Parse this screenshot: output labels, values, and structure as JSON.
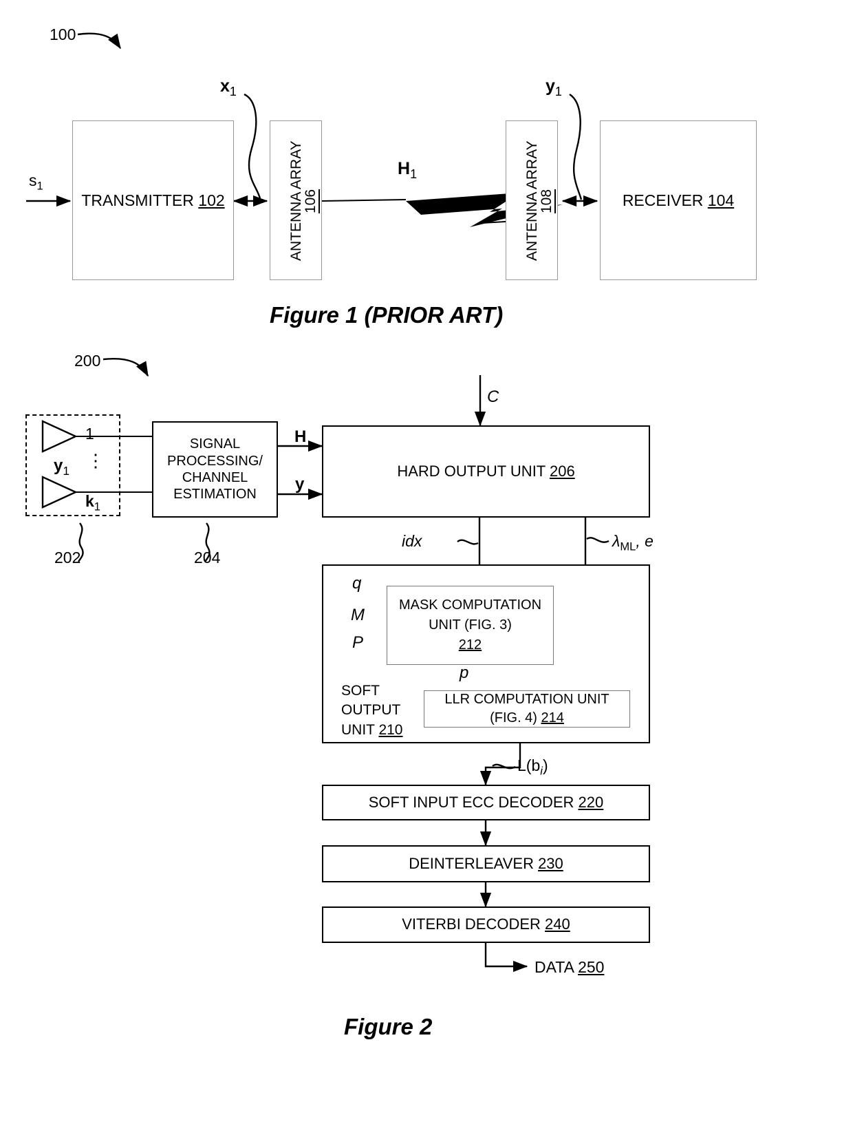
{
  "figure1": {
    "ref_number": "100",
    "caption": "Figure 1 (PRIOR ART)",
    "input_signal_label": "s",
    "input_signal_sub": "1",
    "transmitter": {
      "text": "TRANSMITTER ",
      "ref": "102"
    },
    "antenna_array_tx": {
      "text": "ANTENNA ARRAY",
      "ref": "106"
    },
    "antenna_array_rx": {
      "text": "ANTENNA ARRAY",
      "ref": "108"
    },
    "receiver": {
      "text": "RECEIVER ",
      "ref": "104"
    },
    "x_label": "x",
    "x_sub": "1",
    "y_label": "y",
    "y_sub": "1",
    "channel_label": "H",
    "channel_sub": "1"
  },
  "figure2": {
    "ref_number": "200",
    "caption": "Figure 2",
    "antenna_group": {
      "ref": "202",
      "first_index": "1",
      "last_index": "k",
      "last_index_sub": "1",
      "vector_label": "y",
      "vector_sub": "1",
      "ellipsis": "⋮"
    },
    "signal_processing": {
      "ref": "204",
      "line1": "SIGNAL",
      "line2": "PROCESSING/",
      "line3": "CHANNEL",
      "line4": "ESTIMATION"
    },
    "outputs": {
      "H": "H",
      "y": "y"
    },
    "hard_output_unit": {
      "text": "HARD OUTPUT UNIT ",
      "ref": "206"
    },
    "constellation_input": "C",
    "idx_label": "idx",
    "lambda_label": "λ",
    "lambda_sub": "ML",
    "lambda_rest": ", e",
    "soft_output_unit": {
      "line1": "SOFT",
      "line2": "OUTPUT",
      "line3": "UNIT ",
      "ref": "210"
    },
    "mask_inputs": {
      "q": "q",
      "M": "M",
      "P": "P"
    },
    "mask_computation_unit": {
      "line1": "MASK COMPUTATION",
      "line2": "UNIT (FIG. 3)",
      "ref": "212"
    },
    "p_label": "p",
    "llr_computation_unit": {
      "line1": "LLR COMPUTATION UNIT",
      "line2": "(FIG. 4) ",
      "ref": "214"
    },
    "llr_output_label": "L(b",
    "llr_output_sub": "i",
    "llr_output_close": ")",
    "soft_input_ecc_decoder": {
      "text": "SOFT INPUT ECC DECODER ",
      "ref": "220"
    },
    "deinterleaver": {
      "text": "DEINTERLEAVER ",
      "ref": "230"
    },
    "viterbi_decoder": {
      "text": "VITERBI DECODER ",
      "ref": "240"
    },
    "data_output": {
      "text": "DATA ",
      "ref": "250"
    }
  }
}
